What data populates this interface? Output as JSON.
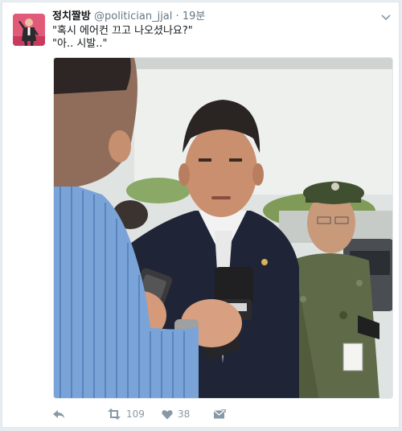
{
  "tweet": {
    "display_name": "정치짤방",
    "handle": "@politician_jjal",
    "separator": "·",
    "time": "19분",
    "text_lines": [
      "\"혹시 에어컨 끄고 나오셨나요?\"",
      "\"아.. 시발..\""
    ],
    "actions": {
      "retweet_count": "109",
      "like_count": "38"
    }
  },
  "icons": {
    "caret": "chevron-down-icon",
    "reply": "reply-icon",
    "retweet": "retweet-icon",
    "like": "heart-icon",
    "message": "envelope-icon"
  },
  "colors": {
    "action_gray": "#8899a6",
    "name": "#14171a",
    "meta": "#657786"
  }
}
